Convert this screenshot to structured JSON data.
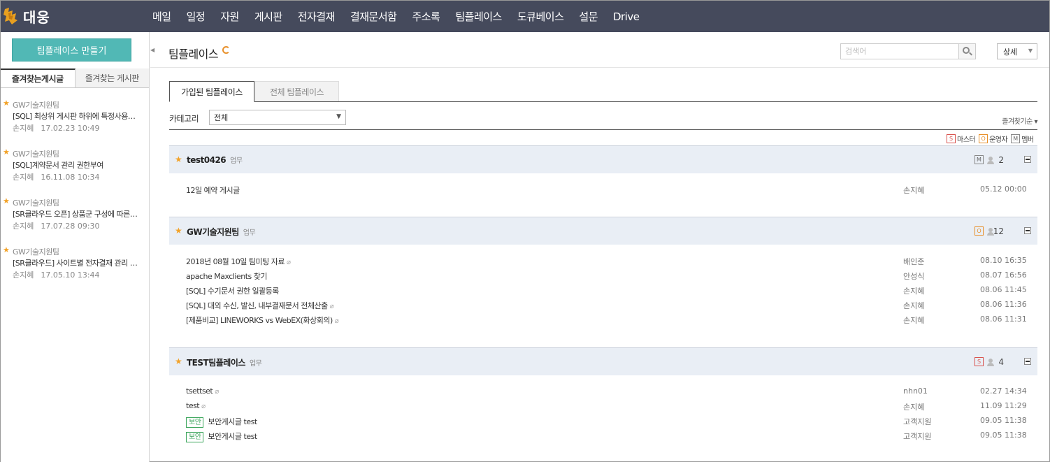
{
  "brand": {
    "name": "대웅",
    "color": "#454a5c",
    "accent": "#51b8b5"
  },
  "nav": [
    "메일",
    "일정",
    "자원",
    "게시판",
    "전자결재",
    "결재문서함",
    "주소록",
    "팀플레이스",
    "도큐베이스",
    "설문",
    "Drive"
  ],
  "sidebar": {
    "create_label": "팀플레이스 만들기",
    "tabs": [
      "즐겨찾는게시글",
      "즐겨찾는 게시판"
    ],
    "favorites": [
      {
        "team": "GW기술지원팀",
        "title": "[SQL] 최상위 게시판 하위에 특정사용자…",
        "author": "손지혜",
        "date": "17.02.23 10:49"
      },
      {
        "team": "GW기술지원팀",
        "title": "[SQL]계약문서 관리 권한부여",
        "author": "손지혜",
        "date": "16.11.08 10:34"
      },
      {
        "team": "GW기술지원팀",
        "title": "[SR클라우드 오픈] 상품군 구성에 따른 …",
        "author": "손지혜",
        "date": "17.07.28 09:30"
      },
      {
        "team": "GW기술지원팀",
        "title": "[SR클라우드] 사이트별 전자결재 관리 …",
        "author": "손지혜",
        "date": "17.05.10 13:44"
      }
    ]
  },
  "header": {
    "title": "팀플레이스",
    "search_placeholder": "검색어",
    "detail_label": "상세"
  },
  "tabs": {
    "joined": "가입된 팀플레이스",
    "all": "전체 팀플레이스"
  },
  "filter": {
    "category_label": "카테고리",
    "category_value": "전체",
    "sort_label": "즐겨찾기순"
  },
  "legend": {
    "master": "마스터",
    "operator": "운영자",
    "member": "멤버"
  },
  "workspaces": [
    {
      "name": "test0426",
      "type": "업무",
      "role": "M",
      "members": "2",
      "posts": [
        {
          "title": "12일 예약 게시글",
          "secure": "",
          "clip": false,
          "author": "손지혜",
          "date": "05.12 00:00"
        }
      ]
    },
    {
      "name": "GW기술지원팀",
      "type": "업무",
      "role": "O",
      "members": "12",
      "posts": [
        {
          "title": "2018년 08월 10일 팀미팅 자료",
          "secure": "",
          "clip": true,
          "author": "배인준",
          "date": "08.10 16:35"
        },
        {
          "title": "apache Maxclients 찾기",
          "secure": "",
          "clip": false,
          "author": "안성식",
          "date": "08.07 16:56"
        },
        {
          "title": "[SQL] 수기문서 권한 일괄등록",
          "secure": "",
          "clip": false,
          "author": "손지혜",
          "date": "08.06 11:45"
        },
        {
          "title": "[SQL] 대외 수신, 발신, 내부결재문서 전체산출",
          "secure": "",
          "clip": true,
          "author": "손지혜",
          "date": "08.06 11:36"
        },
        {
          "title": "[제품비교] LINEWORKS vs WebEX(화상회의)",
          "secure": "",
          "clip": true,
          "author": "손지혜",
          "date": "08.06 11:31"
        }
      ]
    },
    {
      "name": "TEST팀플레이스",
      "type": "업무",
      "role": "S",
      "members": "4",
      "posts": [
        {
          "title": "tsettset",
          "secure": "",
          "clip": true,
          "author": "nhn01",
          "date": "02.27 14:34"
        },
        {
          "title": "test",
          "secure": "",
          "clip": true,
          "author": "손지혜",
          "date": "11.09 11:29"
        },
        {
          "title": "보안게시글 test",
          "secure": "보안",
          "clip": false,
          "author": "고객지원",
          "date": "09.05 11:38"
        },
        {
          "title": "보안게시글 test",
          "secure": "보안",
          "clip": false,
          "author": "고객지원",
          "date": "09.05 11:38"
        }
      ]
    }
  ]
}
